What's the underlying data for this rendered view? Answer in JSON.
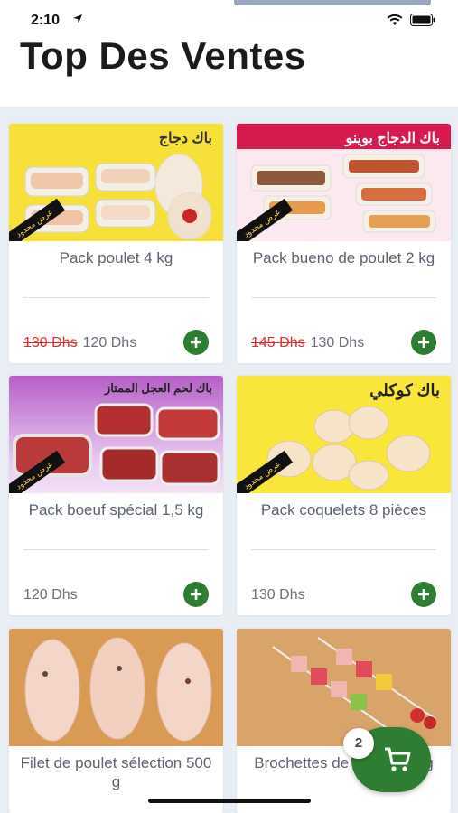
{
  "status_bar": {
    "time": "2:10"
  },
  "header": {
    "title": "Top Des Ventes"
  },
  "products": [
    {
      "name": "Pack poulet 4 kg",
      "old_price": "130 Dhs",
      "price": "120 Dhs",
      "banner": "باك دجاج",
      "badge": "عرض محدود"
    },
    {
      "name": "Pack bueno de poulet 2 kg",
      "old_price": "145 Dhs",
      "price": "130 Dhs",
      "banner": "باك الدجاج بوينو",
      "badge": "عرض محدود"
    },
    {
      "name": "Pack boeuf spécial 1,5 kg",
      "price": "120 Dhs",
      "banner": "باك لحم العجل الممتاز",
      "badge": "عرض محدود"
    },
    {
      "name": "Pack coquelets 8 pièces",
      "price": "130 Dhs",
      "banner": "باك كوكلي",
      "badge": "عرض محدود"
    },
    {
      "name": "Filet de poulet sélection 500 g"
    },
    {
      "name": "Brochettes de dinde 200 g"
    }
  ],
  "cart": {
    "count": "2"
  },
  "colors": {
    "accent_green": "#2e7d32",
    "old_price_red": "#e32a2a"
  }
}
